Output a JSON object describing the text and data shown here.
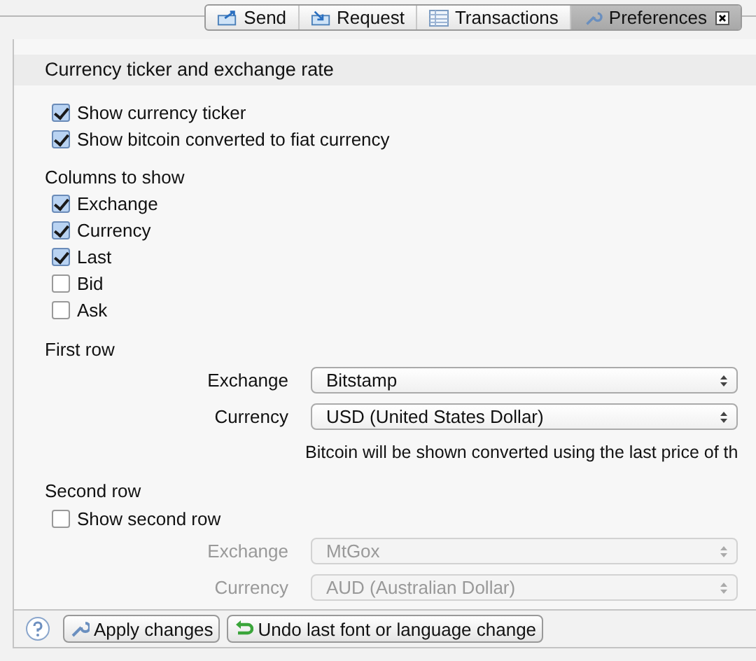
{
  "tabs": [
    {
      "label": "Send",
      "kind": "send",
      "selected": false
    },
    {
      "label": "Request",
      "kind": "request",
      "selected": false
    },
    {
      "label": "Transactions",
      "kind": "transactions",
      "selected": false
    },
    {
      "label": "Preferences",
      "kind": "preferences",
      "selected": true
    }
  ],
  "section_title": "Currency ticker and exchange rate",
  "general_options": [
    {
      "label": "Show currency ticker",
      "checked": true
    },
    {
      "label": "Show bitcoin converted to fiat currency",
      "checked": true
    }
  ],
  "columns_heading": "Columns to show",
  "columns": [
    {
      "label": "Exchange",
      "checked": true
    },
    {
      "label": "Currency",
      "checked": true
    },
    {
      "label": "Last",
      "checked": true
    },
    {
      "label": "Bid",
      "checked": false
    },
    {
      "label": "Ask",
      "checked": false
    }
  ],
  "first_row": {
    "heading": "First row",
    "fields": [
      {
        "label": "Exchange",
        "value": "Bitstamp",
        "disabled": false
      },
      {
        "label": "Currency",
        "value": "USD (United States Dollar)",
        "disabled": false
      }
    ],
    "note": "Bitcoin will be shown converted using the last price of th"
  },
  "second_row": {
    "heading": "Second row",
    "toggle": {
      "label": "Show second row",
      "checked": false
    },
    "fields": [
      {
        "label": "Exchange",
        "value": "MtGox",
        "disabled": true
      },
      {
        "label": "Currency",
        "value": "AUD (Australian Dollar)",
        "disabled": true
      }
    ]
  },
  "buttons": [
    {
      "label": "Apply changes",
      "kind": "apply"
    },
    {
      "label": "Undo last font or language change",
      "kind": "undo"
    }
  ]
}
